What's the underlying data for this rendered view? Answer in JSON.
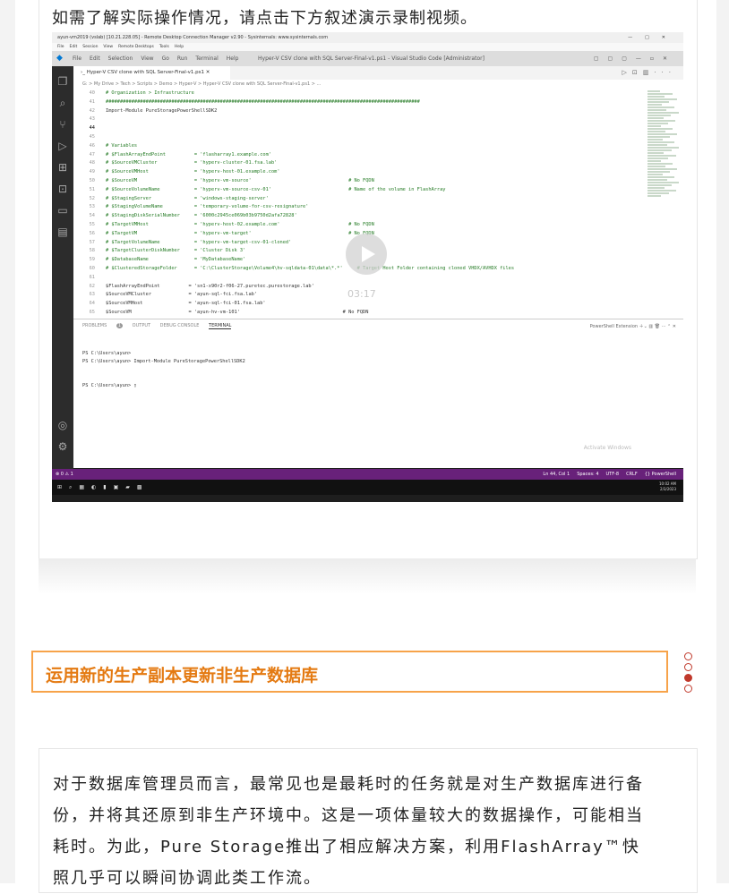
{
  "intro_text": "如需了解实际操作情况，请点击下方叙述演示录制视频。",
  "video": {
    "rd_title": "ayun-vm2019 (vslab) [10.21.228.05] - Remote Desktop Connection Manager v2.90 - Sysinternals: www.sysinternals.com",
    "rd_menu": [
      "File",
      "Edit",
      "Session",
      "View",
      "Remote Desktops",
      "Tools",
      "Help"
    ],
    "vscode_menu": [
      "File",
      "Edit",
      "Selection",
      "View",
      "Go",
      "Run",
      "Terminal",
      "Help"
    ],
    "window_title": "Hyper-V CSV clone with SQL Server-Final-v1.ps1 - Visual Studio Code [Administrator]",
    "tab_label": "Hyper-V CSV clone with SQL Server-Final-v1.ps1",
    "breadcrumb": "G: > My Drive > Tech > Scripts > Demo > Hyper-V > Hyper-V CSV clone with SQL Server-Final-v1.ps1 > ...",
    "code_lines": [
      {
        "n": "40",
        "text": "# Organization > Infrastructure",
        "kind": "cmt"
      },
      {
        "n": "41",
        "text": "##############################################################################################################",
        "kind": "cmt"
      },
      {
        "n": "42",
        "text": "Import-Module PureStoragePowerShellSDK2",
        "kind": "kw"
      },
      {
        "n": "43",
        "text": "",
        "kind": "kw"
      },
      {
        "n": "44",
        "text": "",
        "kind": "kw"
      },
      {
        "n": "45",
        "text": "",
        "kind": "kw"
      },
      {
        "n": "46",
        "text": "# Variables",
        "kind": "cmt"
      },
      {
        "n": "47",
        "text": "# $FlashArrayEndPoint          = 'flasharray1.example.com'",
        "kind": "cmt"
      },
      {
        "n": "48",
        "text": "# $SourceVMCluster             = 'hyperv-cluster-01.fsa.lab'",
        "kind": "cmt"
      },
      {
        "n": "49",
        "text": "# $SourceVMHost                = 'hyperv-host-01.example.com'",
        "kind": "cmt"
      },
      {
        "n": "50",
        "text": "# $SourceVM                    = 'hyperv-vm-source'                                  # No FQDN",
        "kind": "cmt"
      },
      {
        "n": "51",
        "text": "# $SourceVolumeName            = 'hyperv-vm-source-csv-01'                           # Name of the volume in FlashArray",
        "kind": "cmt"
      },
      {
        "n": "52",
        "text": "# $StagingServer               = 'windows-staging-server'",
        "kind": "cmt"
      },
      {
        "n": "53",
        "text": "# $StagingVolumeName           = 'temporary-volume-for-csv-resignature'",
        "kind": "cmt"
      },
      {
        "n": "54",
        "text": "# $StagingDiskSerialNumber     = '6000c2945ce069b03b9750d2afa72828'",
        "kind": "cmt"
      },
      {
        "n": "55",
        "text": "# $TargetVMHost                = 'hyperv-host-02.example.com'                        # No FQDN",
        "kind": "cmt"
      },
      {
        "n": "56",
        "text": "# $TargetVM                    = 'hyperv-vm-target'                                  # No FQDN",
        "kind": "cmt"
      },
      {
        "n": "57",
        "text": "# $TargetVolumeName            = 'hyperv-vm-target-csv-01-cloned'",
        "kind": "cmt"
      },
      {
        "n": "58",
        "text": "# $TargetClusterDiskNumber     = 'Cluster Disk 3'",
        "kind": "cmt"
      },
      {
        "n": "59",
        "text": "# $DatabaseName                = 'MyDatabaseName'",
        "kind": "cmt"
      },
      {
        "n": "60",
        "text": "# $ClusteredStorageFolder      = 'C:\\ClusterStorage\\Volume4\\hv-sqldata-01\\data\\*.*'     # Target Host Folder containing cloned VHDX/AVHDX files",
        "kind": "cmt"
      },
      {
        "n": "61",
        "text": "",
        "kind": "kw"
      },
      {
        "n": "62",
        "text": "$FlashArrayEndPoint          = 'sn1-x90r2-f06-27.puretec.purestorage.lab'",
        "kind": "kw"
      },
      {
        "n": "63",
        "text": "$SourceVMCluster             = 'ayun-sql-fci.fsa.lab'",
        "kind": "kw"
      },
      {
        "n": "64",
        "text": "$SourceVMHost                = 'ayun-sql-fci-01.fsa.lab'",
        "kind": "kw"
      },
      {
        "n": "65",
        "text": "$SourceVM                    = 'ayun-hv-vm-101'                                    # No FQDN",
        "kind": "kw"
      }
    ],
    "duration": "03:17",
    "panel_tabs": [
      "PROBLEMS",
      "OUTPUT",
      "DEBUG CONSOLE",
      "TERMINAL"
    ],
    "problems_count": "1",
    "panel_right": "PowerShell Extension",
    "terminal_lines": [
      "PS C:\\Users\\ayun>",
      "PS C:\\Users\\ayun> Import-Module PureStoragePowerShellSDK2",
      "",
      "",
      "PS C:\\Users\\ayun> ▯"
    ],
    "watermark": "Activate Windows",
    "status_left": "⊗ 0 ⚠ 1",
    "status_right": [
      "Ln 44, Col 1",
      "Spaces: 4",
      "UTF-8",
      "CRLF",
      "{} PowerShell"
    ],
    "clock_time": "10:02 AM",
    "clock_date": "2/3/2023"
  },
  "section_heading": "运用新的生产副本更新非生产数据库",
  "paragraph_lines": [
    "对于数据库管理员而言，最常见也是最耗时的任务就是对生产数据库进行备",
    "份，并将其还原到非生产环境中。这是一项体量较大的数据操作，可能相当",
    "耗时。为此，Pure Storage推出了相应解决方案，利用FlashArray™快",
    "照几乎可以瞬间协调此类工作流。"
  ],
  "colors": {
    "heading": "#e47a12",
    "heading_border": "#f7a34a",
    "dots": "#c0392b",
    "status_bar": "#68217a"
  }
}
